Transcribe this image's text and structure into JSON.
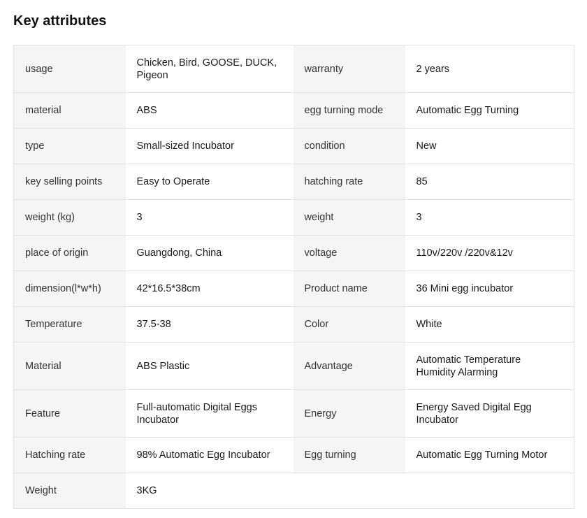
{
  "section": {
    "title": "Key attributes"
  },
  "attributes": [
    {
      "k1": "usage",
      "v1": "Chicken, Bird, GOOSE, DUCK, Pigeon",
      "k2": "warranty",
      "v2": "2 years"
    },
    {
      "k1": "material",
      "v1": "ABS",
      "k2": "egg turning mode",
      "v2": "Automatic Egg Turning"
    },
    {
      "k1": "type",
      "v1": "Small-sized Incubator",
      "k2": "condition",
      "v2": "New"
    },
    {
      "k1": "key selling points",
      "v1": "Easy to Operate",
      "k2": "hatching rate",
      "v2": "85"
    },
    {
      "k1": "weight (kg)",
      "v1": "3",
      "k2": "weight",
      "v2": "3"
    },
    {
      "k1": "place of origin",
      "v1": "Guangdong, China",
      "k2": "voltage",
      "v2": "110v/220v /220v&12v"
    },
    {
      "k1": "dimension(l*w*h)",
      "v1": "42*16.5*38cm",
      "k2": "Product name",
      "v2": "36 Mini egg incubator"
    },
    {
      "k1": "Temperature",
      "v1": "37.5-38",
      "k2": "Color",
      "v2": "White"
    },
    {
      "k1": "Material",
      "v1": "ABS Plastic",
      "k2": "Advantage",
      "v2": "Automatic Temperature Humidity Alarming"
    },
    {
      "k1": "Feature",
      "v1": "Full-automatic Digital Eggs Incubator",
      "k2": "Energy",
      "v2": "Energy Saved Digital Egg Incubator"
    },
    {
      "k1": "Hatching rate",
      "v1": "98% Automatic Egg Incubator",
      "k2": "Egg turning",
      "v2": "Automatic Egg Turning Motor"
    },
    {
      "k1": "Weight",
      "v1": "3KG"
    }
  ]
}
